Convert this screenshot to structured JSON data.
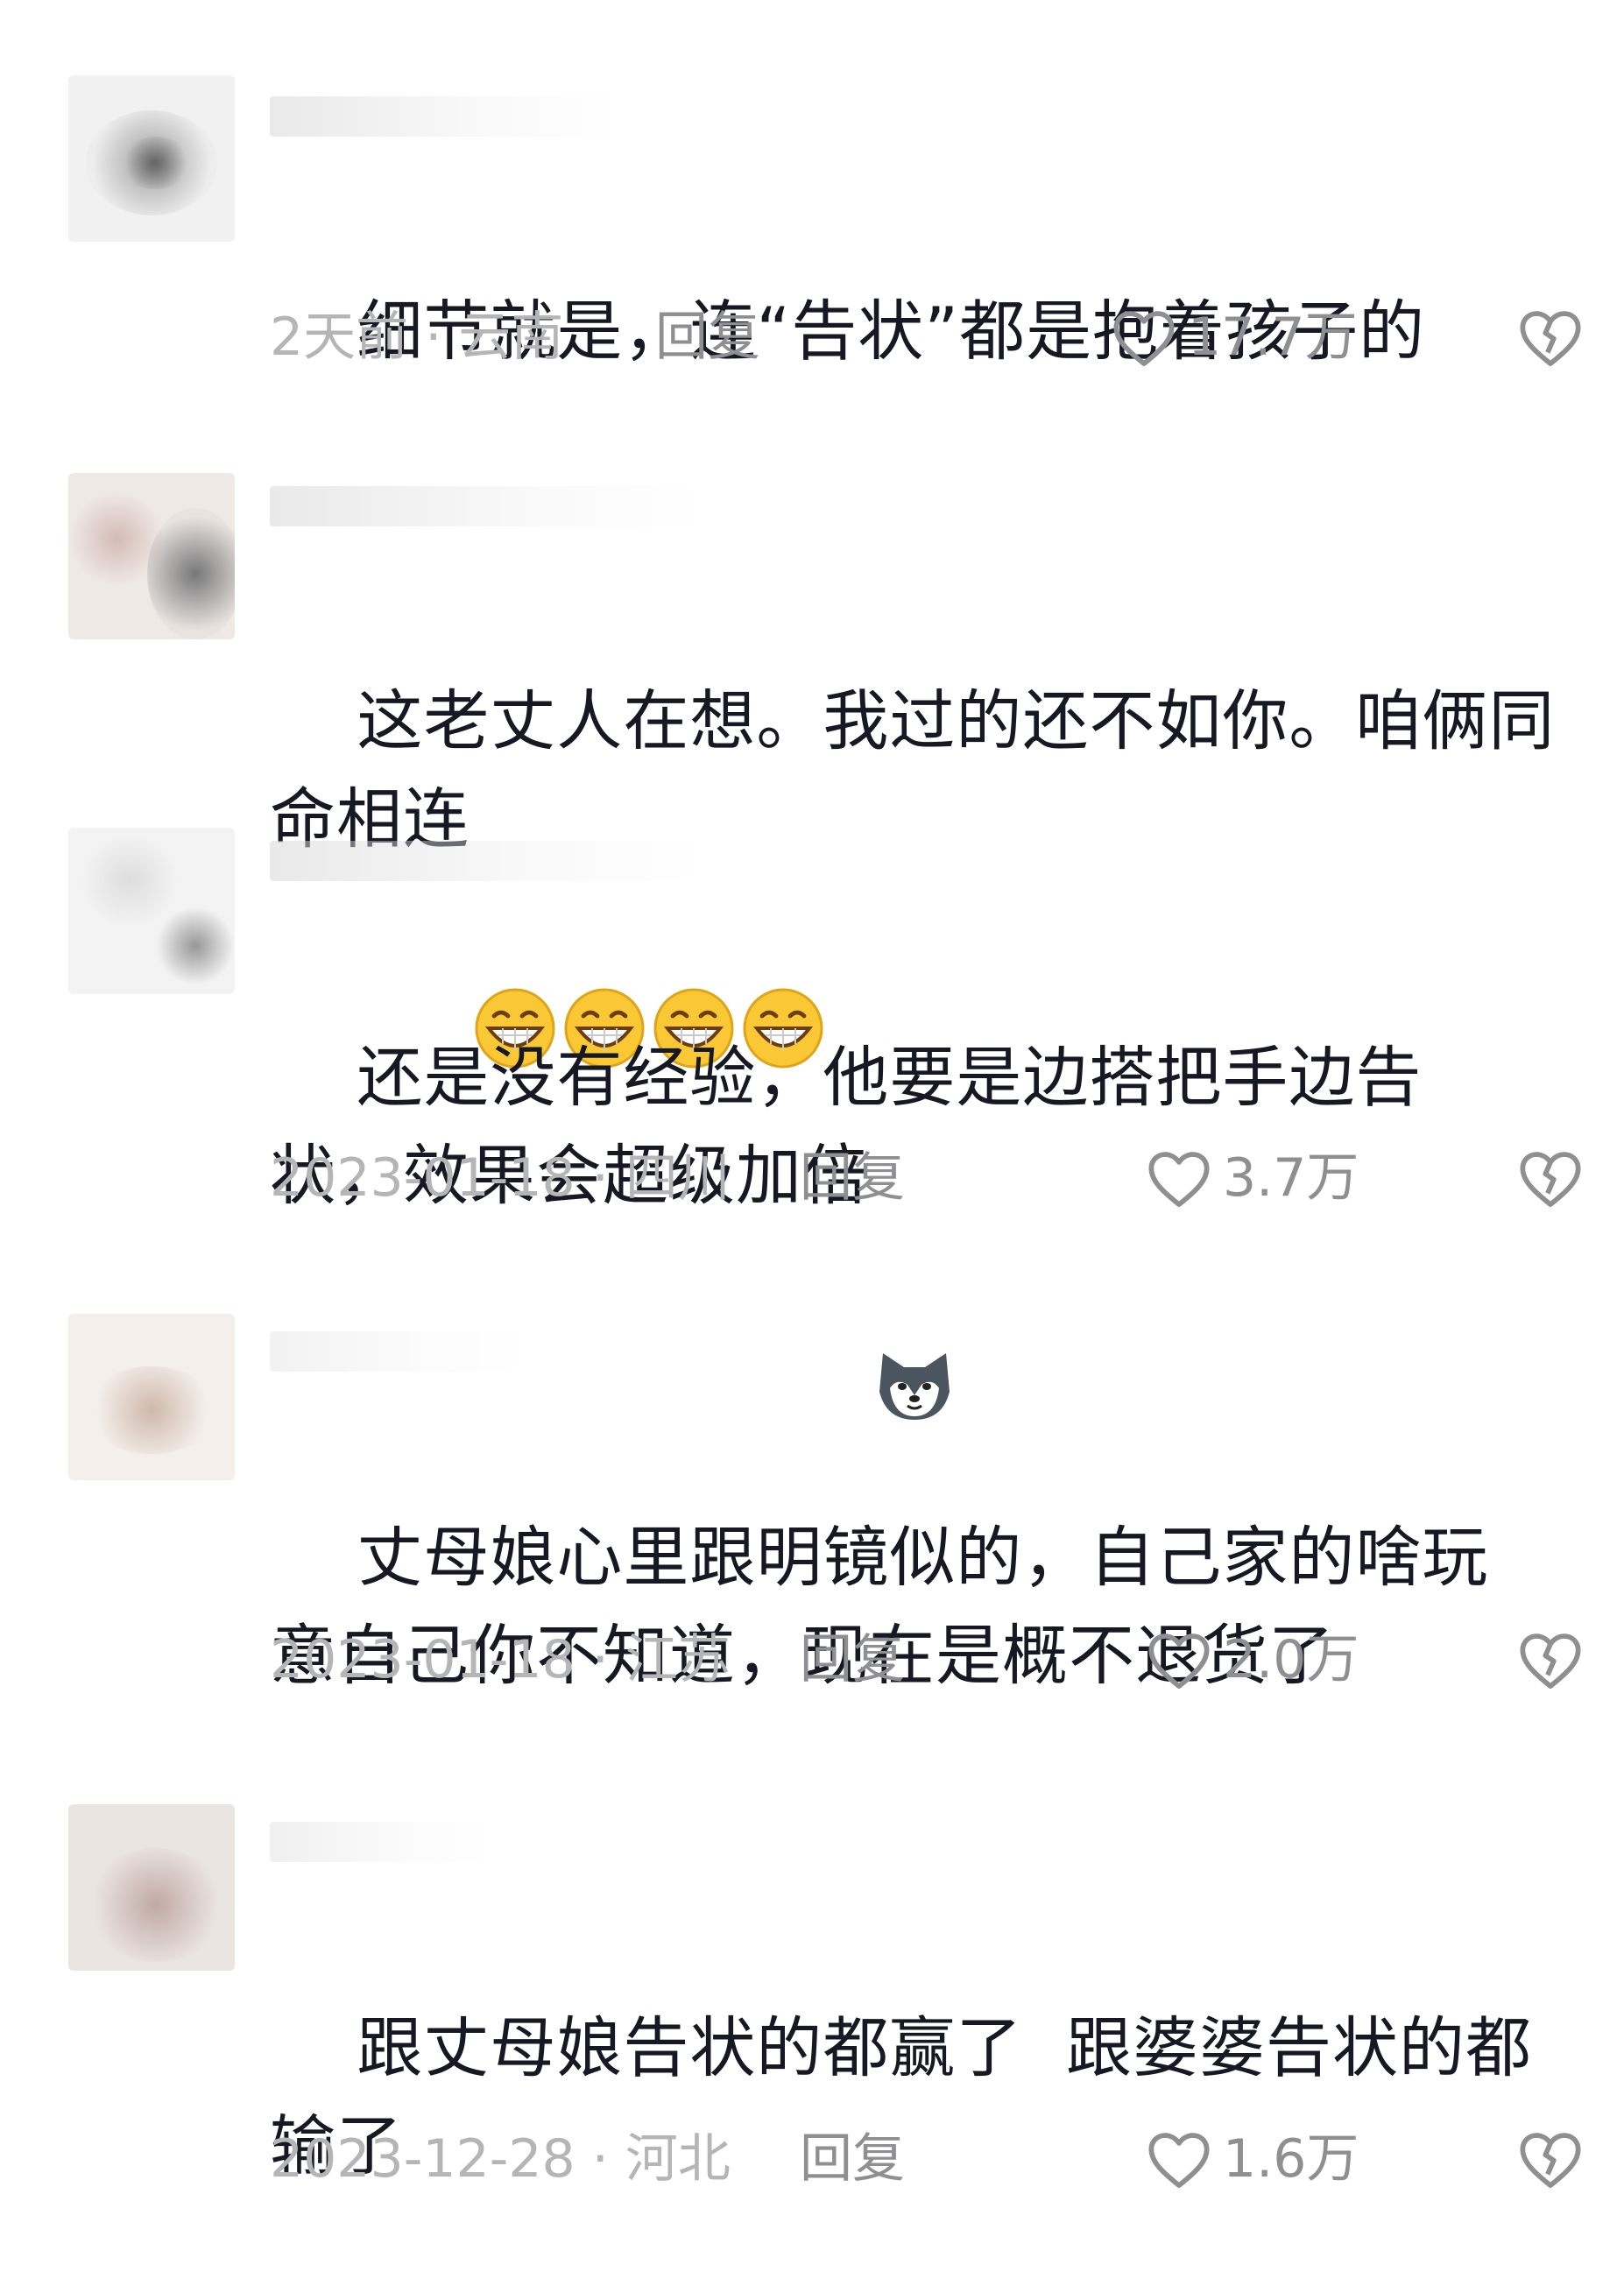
{
  "comments": [
    {
      "text": "细节就是，连“告状”都是抱着孩子的",
      "date": "2天前 · 云南",
      "reply": "回复",
      "likes": "17.7万",
      "emoji": []
    },
    {
      "text": "这老丈人在想。我过的还不如你。咱俩同命相连",
      "emoji": [
        "grin-emoji",
        "grin-emoji",
        "grin-emoji",
        "grin-emoji"
      ]
    },
    {
      "text": "还是没有经验，他要是边搭把手边告状，效果会超级加倍",
      "date": "2023-01-18 · 四川",
      "reply": "回复",
      "likes": "3.7万",
      "emoji": [
        "husky-emoji"
      ]
    },
    {
      "text": "丈母娘心里跟明镜似的，自己家的啥玩意自己你不知道，现在是概不退货了",
      "date": "2023-01-18 · 江苏",
      "reply": "回复",
      "likes": "2.0万",
      "emoji": []
    },
    {
      "text": "跟丈母娘告状的都赢了  跟婆婆告状的都输了",
      "date": "2023-12-28 · 河北",
      "reply": "回复",
      "likes": "1.6万",
      "emoji": []
    }
  ],
  "icons": {
    "like": "heart-outline-icon",
    "dislike": "broken-heart-icon"
  },
  "colors": {
    "text": "#161823",
    "meta": "#b5b5b8",
    "action": "#8f8f93"
  }
}
